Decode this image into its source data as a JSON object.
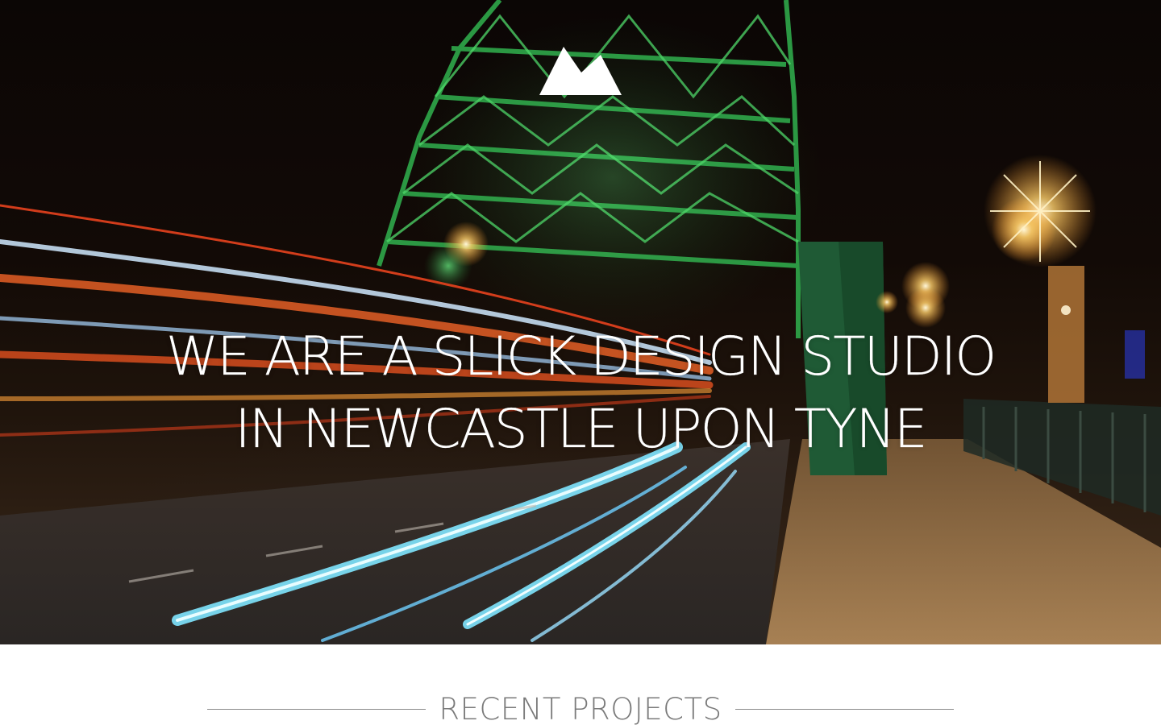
{
  "hero": {
    "headline_line1": "WE ARE A SLICK DESIGN STUDIO",
    "headline_line2": "IN NEWCASTLE UPON TYNE",
    "logo_icon": "mountain-crown-icon"
  },
  "projects": {
    "title": "RECENT PROJECTS"
  },
  "colors": {
    "bridge_green": "#2fa84a",
    "light_trail_blue": "#7fe6ff",
    "light_trail_red": "#e8421e",
    "lamp_glow": "#ffd27a",
    "section_title": "#7a7a7a"
  }
}
